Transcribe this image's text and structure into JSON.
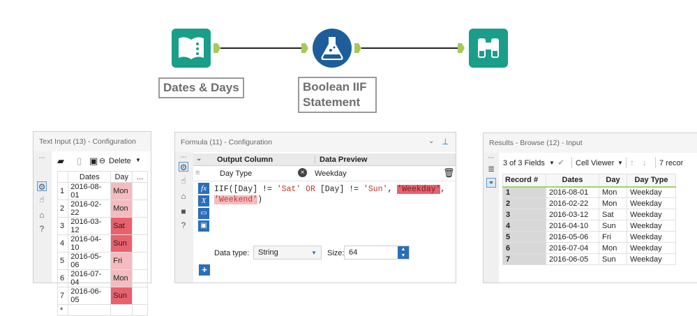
{
  "workflow": {
    "tool1_label": "Dates & Days",
    "tool2_label_line1": "Boolean IIF",
    "tool2_label_line2": "Statement"
  },
  "text_input": {
    "title": "Text Input (13) - Configuration",
    "delete_label": "Delete",
    "columns": [
      "Dates",
      "Day",
      "..."
    ],
    "rows": [
      {
        "n": "1",
        "date": "2016-08-01",
        "day": "Mon"
      },
      {
        "n": "2",
        "date": "2016-02-22",
        "day": "Mon"
      },
      {
        "n": "3",
        "date": "2016-03-12",
        "day": "Sat"
      },
      {
        "n": "4",
        "date": "2016-04-10",
        "day": "Sun"
      },
      {
        "n": "5",
        "date": "2016-05-06",
        "day": "Fri"
      },
      {
        "n": "6",
        "date": "2016-07-04",
        "day": "Mon"
      },
      {
        "n": "7",
        "date": "2016-06-05",
        "day": "Sun"
      }
    ],
    "new_row_marker": "*"
  },
  "formula": {
    "title": "Formula (11) - Configuration",
    "col_output": "Output Column",
    "col_preview": "Data Preview",
    "output_column_value": "Day Type",
    "preview_value": "Weekday",
    "expr_part1": "IIF([Day] != ",
    "expr_str1": "'Sat'",
    "expr_or": " OR ",
    "expr_part2": "[Day] != ",
    "expr_str2": "'Sun'",
    "expr_comma": ", ",
    "expr_weekday": "'Weekday'",
    "expr_comma2": ",",
    "expr_weekend": "'Weekend'",
    "expr_close": ")",
    "data_type_label": "Data type:",
    "data_type_value": "String",
    "size_label": "Size:",
    "size_value": "64",
    "add_label": "+",
    "fx_label": "fx",
    "x_label": "X"
  },
  "results": {
    "title": "Results - Browse (12) - Input",
    "fields_label": "3 of 3 Fields",
    "viewer_label": "Cell Viewer",
    "records_label": "7 recor",
    "columns": [
      "Record #",
      "Dates",
      "Day",
      "Day Type"
    ],
    "rows": [
      {
        "n": "1",
        "date": "2016-08-01",
        "day": "Mon",
        "type": "Weekday"
      },
      {
        "n": "2",
        "date": "2016-02-22",
        "day": "Mon",
        "type": "Weekday"
      },
      {
        "n": "3",
        "date": "2016-03-12",
        "day": "Sat",
        "type": "Weekday"
      },
      {
        "n": "4",
        "date": "2016-04-10",
        "day": "Sun",
        "type": "Weekday"
      },
      {
        "n": "5",
        "date": "2016-05-06",
        "day": "Fri",
        "type": "Weekday"
      },
      {
        "n": "6",
        "date": "2016-07-04",
        "day": "Mon",
        "type": "Weekday"
      },
      {
        "n": "7",
        "date": "2016-06-05",
        "day": "Sun",
        "type": "Weekday"
      }
    ]
  }
}
